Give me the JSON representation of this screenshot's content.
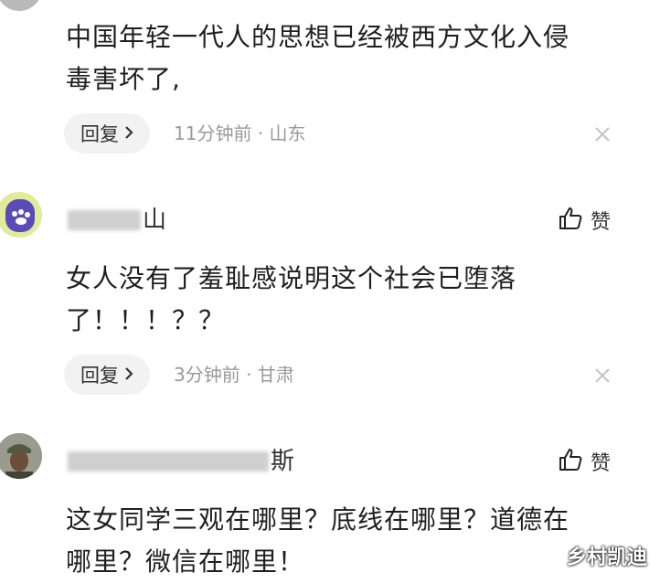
{
  "comments": [
    {
      "text_line1": "中国年轻一代人的思想已经被西方文化入侵",
      "text_line2": "毒害坏了,",
      "reply_label": "回复",
      "meta": "11分钟前 · 山东"
    },
    {
      "username_visible": "山",
      "like_label": "赞",
      "text_line1": "女人没有了羞耻感说明这个社会已堕落",
      "text_line2": "了！！！？？",
      "reply_label": "回复",
      "meta": "3分钟前 · 甘肃"
    },
    {
      "username_visible": "斯",
      "like_label": "赞",
      "text_line1": "这女同学三观在哪里？底线在哪里？道德在",
      "text_line2": "哪里？微信在哪里！"
    }
  ],
  "watermark": "乡村凯迪",
  "icons": {
    "reply_chevron": "chevron-right-icon",
    "close": "close-icon",
    "like": "thumbs-up-icon",
    "avatar_cat": "paw-icon"
  }
}
